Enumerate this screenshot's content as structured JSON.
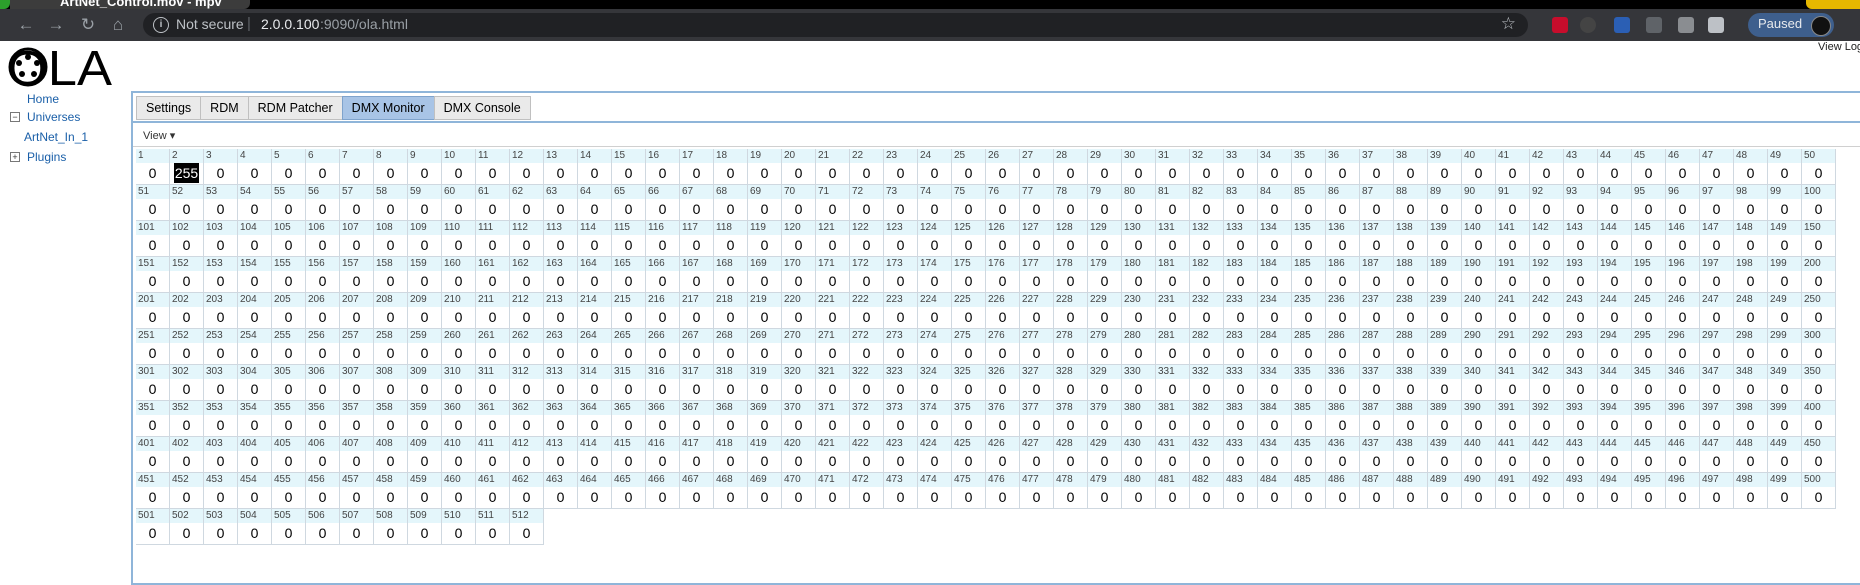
{
  "browser": {
    "tab_title": "ArtNet_Control.mov - mpv",
    "secure_label": "Not secure",
    "url_host": "2.0.0.100",
    "url_rest": ":9090/ola.html",
    "paused_label": "Paused",
    "extensions": [
      "abp-icon",
      "extension-icon",
      "word-icon",
      "pen-icon",
      "vr-icon",
      "puzzle-icon"
    ]
  },
  "logo": "OLA",
  "view_logs": "View Logs",
  "nav": {
    "home": "Home",
    "universes": "Universes",
    "universe_item": "ArtNet_In_1",
    "plugins": "Plugins"
  },
  "tabs": [
    "Settings",
    "RDM",
    "RDM Patcher",
    "DMX Monitor",
    "DMX Console"
  ],
  "active_tab": "DMX Monitor",
  "view_menu": "View ▾",
  "dmx": {
    "channel_count": 512,
    "default_value": 0,
    "overrides": {
      "2": 255
    },
    "highlight_channel": 2
  }
}
